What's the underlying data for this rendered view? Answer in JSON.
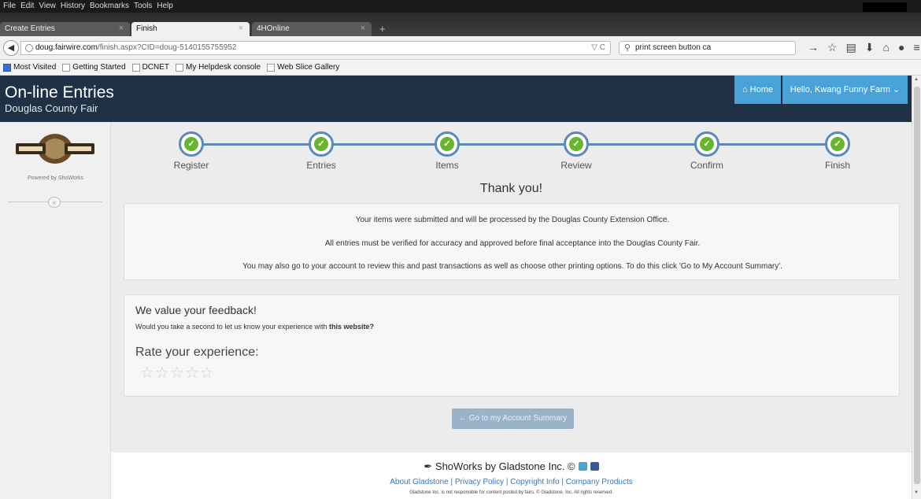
{
  "browser": {
    "menu": [
      "File",
      "Edit",
      "View",
      "History",
      "Bookmarks",
      "Tools",
      "Help"
    ],
    "tabs": [
      {
        "label": "Create Entries",
        "close": "×"
      },
      {
        "label": "Finish",
        "close": "×"
      },
      {
        "label": "4HOnline",
        "close": "×"
      }
    ],
    "new_tab": "+",
    "url_host": "doug.fairwire.com",
    "url_path": "/finish.aspx?CID=doug-5140155755952",
    "url_tools": "▽ C",
    "search_value": "print screen button ca",
    "bookmarks": [
      "Most Visited",
      "Getting Started",
      "DCNET",
      "My Helpdesk console",
      "Web Slice Gallery"
    ]
  },
  "header": {
    "title": "On-line Entries",
    "subtitle": "Douglas County Fair",
    "home_label": "Home",
    "user_label": "Hello, Kwang Funny Farm"
  },
  "sidebar": {
    "powered_by": "Powered by ShoWorks",
    "collapse_glyph": "«"
  },
  "steps": [
    "Register",
    "Entries",
    "Items",
    "Review",
    "Confirm",
    "Finish"
  ],
  "thank_you": "Thank you!",
  "messages": [
    "Your items were submitted and will be processed by the Douglas County Extension Office.",
    "All entries must be verified for accuracy and approved before final acceptance into the Douglas County Fair.",
    "You may also go to your account to review this and past transactions as well as choose other printing options. To do this click 'Go to My Account Summary'."
  ],
  "feedback": {
    "title": "We value your feedback!",
    "ask_prefix": "Would you take a second to let us know your experience with ",
    "ask_bold": "this website?",
    "rate_label": "Rate your experience:",
    "rating": 0,
    "max_rating": 5
  },
  "account_button": "Go to my Account Summary",
  "footer": {
    "brand": "ShoWorks by Gladstone Inc. ©",
    "links": [
      "About Gladstone",
      "Privacy Policy",
      "Copyright Info",
      "Company Products"
    ],
    "legal": "Gladstone Inc. is not responsible for content posted by fairs. © Gladstone, Inc. All rights reserved."
  }
}
